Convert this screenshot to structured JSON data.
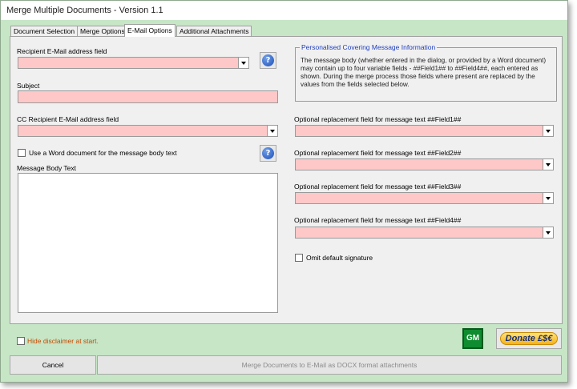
{
  "window": {
    "title": "Merge Multiple Documents - Version 1.1"
  },
  "tabs": [
    {
      "label": "Document Selection"
    },
    {
      "label": "Merge Options"
    },
    {
      "label": "E-Mail Options"
    },
    {
      "label": "Additional Attachments"
    }
  ],
  "active_tab": "E-Mail Options",
  "left": {
    "recipient_label": "Recipient E-Mail address field",
    "recipient_value": "",
    "subject_label": "Subject",
    "subject_value": "",
    "cc_label": "CC Recipient E-Mail address field",
    "cc_value": "",
    "use_word_label": "Use a Word document for the message body text",
    "use_word_checked": false,
    "body_label": "Message Body Text",
    "body_value": ""
  },
  "info": {
    "title": "Personalised Covering Message Information",
    "text": "The message body (whether entered in the dialog, or provided by a Word document) may contain up to four variable fields - ##Field1## to ##Field4##, each entered as shown. During the merge process those fields where present are replaced by the values from the fields selected below."
  },
  "fields": [
    {
      "label": "Optional replacement field for message text ##Field1##",
      "value": ""
    },
    {
      "label": "Optional replacement field for message text ##Field2##",
      "value": ""
    },
    {
      "label": "Optional replacement field for message text ##Field3##",
      "value": ""
    },
    {
      "label": "Optional replacement field for message text ##Field4##",
      "value": ""
    }
  ],
  "omit_signature": {
    "label": "Omit default signature",
    "checked": false
  },
  "footer": {
    "hide_disclaimer_label": "Hide disclaimer at start.",
    "hide_disclaimer_checked": false,
    "gm_label": "GM",
    "donate_label": "Donate £$€",
    "cancel_label": "Cancel",
    "merge_label": "Merge Documents to E-Mail as DOCX format attachments"
  },
  "colors": {
    "window_bg": "#c6e6c6",
    "field_bg": "#ffc8c8",
    "info_title": "#1f3fbf",
    "disclaimer_text": "#c84a00"
  },
  "icons": {
    "help": "help-icon",
    "dropdown": "chevron-down-icon"
  }
}
